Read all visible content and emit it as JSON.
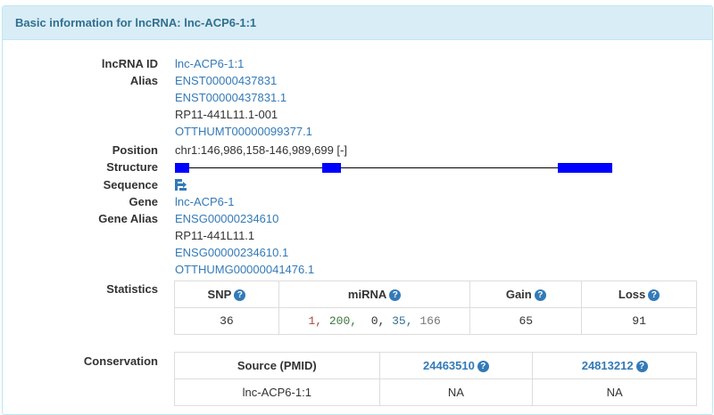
{
  "panel": {
    "title": "Basic information for lncRNA: lnc-ACP6-1:1"
  },
  "fields": {
    "lncrna_id": {
      "label": "lncRNA ID",
      "value": "lnc-ACP6-1:1"
    },
    "alias": {
      "label": "Alias",
      "values": [
        "ENST00000437831",
        "ENST00000437831.1",
        "RP11-441L11.1-001",
        "OTTHUMT00000099377.1"
      ]
    },
    "position": {
      "label": "Position",
      "value": "chr1:146,986,158-146,989,699 [-]"
    },
    "structure": {
      "label": "Structure"
    },
    "sequence": {
      "label": "Sequence",
      "icon": "sequence-icon"
    },
    "gene": {
      "label": "Gene",
      "value": "lnc-ACP6-1"
    },
    "gene_alias": {
      "label": "Gene Alias",
      "values": [
        "ENSG00000234610",
        "RP11-441L11.1",
        "ENSG00000234610.1",
        "OTTHUMG00000041476.1"
      ]
    },
    "statistics": {
      "label": "Statistics"
    },
    "conservation": {
      "label": "Conservation"
    }
  },
  "statistics_table": {
    "headers": [
      "SNP",
      "miRNA",
      "Gain",
      "Loss"
    ],
    "snp": "36",
    "mirna": [
      {
        "text": "1,",
        "color": "#a94442"
      },
      {
        "text": "200,",
        "color": "#3c763d"
      },
      {
        "text": "0,",
        "color": "#333333"
      },
      {
        "text": "35,",
        "color": "#31708f"
      },
      {
        "text": "166",
        "color": "#777777"
      }
    ],
    "gain": "65",
    "loss": "91"
  },
  "conservation_table": {
    "headers": [
      "Source (PMID)",
      "24463510",
      "24813212"
    ],
    "row": [
      "lnc-ACP6-1:1",
      "NA",
      "NA"
    ]
  },
  "colors": {
    "heading_bg": "#d9edf7",
    "heading_text": "#31708f",
    "link": "#337ab7",
    "exon": "#0000ff"
  }
}
